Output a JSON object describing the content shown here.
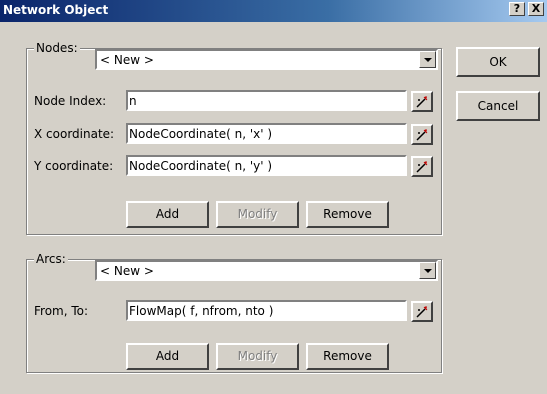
{
  "window": {
    "title": "Network Object",
    "help_label": "?",
    "close_label": "X"
  },
  "nodes": {
    "legend": "Nodes:",
    "selector_value": "< New >",
    "node_index_label": "Node Index:",
    "node_index_value": "n",
    "x_label": "X coordinate:",
    "x_value": "NodeCoordinate( n, 'x' )",
    "y_label": "Y coordinate:",
    "y_value": "NodeCoordinate( n, 'y' )",
    "add_label": "Add",
    "modify_label": "Modify",
    "remove_label": "Remove"
  },
  "arcs": {
    "legend": "Arcs:",
    "selector_value": "< New >",
    "from_to_label": "From, To:",
    "from_to_value": "FlowMap( f, nfrom, nto )",
    "add_label": "Add",
    "modify_label": "Modify",
    "remove_label": "Remove"
  },
  "dialog_buttons": {
    "ok_label": "OK",
    "cancel_label": "Cancel"
  },
  "icons": {
    "expression_button": "expression-wand-icon",
    "dropdown": "chevron-down-icon"
  }
}
